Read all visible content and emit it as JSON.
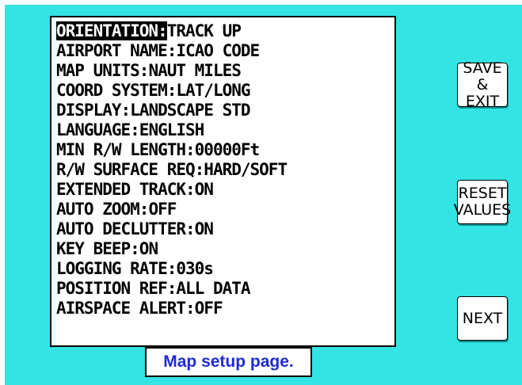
{
  "settings": [
    {
      "key": "ORIENTATION:",
      "value": "TRACK UP",
      "selected": true
    },
    {
      "key": "AIRPORT NAME:",
      "value": "ICAO CODE"
    },
    {
      "key": "MAP UNITS:",
      "value": "NAUT MILES"
    },
    {
      "key": "COORD SYSTEM:",
      "value": "LAT/LONG"
    },
    {
      "key": "DISPLAY:",
      "value": "LANDSCAPE STD"
    },
    {
      "key": "LANGUAGE:",
      "value": "ENGLISH"
    },
    {
      "key": "MIN R/W LENGTH:",
      "value": "00000Ft"
    },
    {
      "key": "R/W SURFACE REQ:",
      "value": "HARD/SOFT"
    },
    {
      "key": "EXTENDED TRACK:",
      "value": "ON"
    },
    {
      "key": "AUTO ZOOM:",
      "value": "OFF"
    },
    {
      "key": "AUTO DECLUTTER:",
      "value": "ON"
    },
    {
      "key": "KEY BEEP:",
      "value": "ON"
    },
    {
      "key": "LOGGING RATE:",
      "value": "030s"
    },
    {
      "key": "POSITION REF:",
      "value": "ALL DATA"
    },
    {
      "key": "AIRSPACE ALERT:",
      "value": "OFF"
    }
  ],
  "buttons": {
    "save_exit": [
      "SAVE &",
      "EXIT"
    ],
    "reset_values": [
      "RESET",
      "VALUES"
    ],
    "next": [
      "NEXT"
    ]
  },
  "caption": "Map setup page.",
  "colors": {
    "background": "#34e3e3",
    "selected_bg": "#000000",
    "selected_fg": "#ffffff",
    "caption_text": "#1f2bd6"
  }
}
